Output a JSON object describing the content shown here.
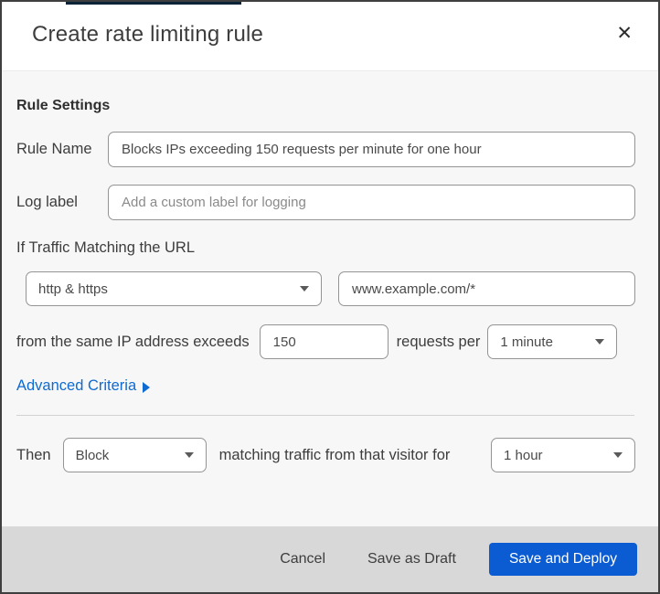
{
  "modal": {
    "title": "Create rate limiting rule",
    "close_icon": "✕"
  },
  "form": {
    "section_heading": "Rule Settings",
    "rule_name": {
      "label": "Rule Name",
      "value": "Blocks IPs exceeding 150 requests per minute for one hour"
    },
    "log_label": {
      "label": "Log label",
      "placeholder": "Add a custom label for logging"
    },
    "traffic_match": {
      "heading": "If Traffic Matching the URL",
      "scheme_selected": "http & https",
      "url_value": "www.example.com/*"
    },
    "threshold": {
      "prefix": "from the same IP address exceeds",
      "requests_value": "150",
      "middle": "requests per",
      "period_selected": "1 minute"
    },
    "advanced_criteria_label": "Advanced Criteria",
    "action": {
      "prefix": "Then",
      "action_selected": "Block",
      "middle": "matching traffic from that visitor for",
      "duration_selected": "1 hour"
    }
  },
  "footer": {
    "cancel_label": "Cancel",
    "save_draft_label": "Save as Draft",
    "save_deploy_label": "Save and Deploy"
  },
  "colors": {
    "accent_blue": "#0b5bd3",
    "link_blue": "#0f6ad1",
    "body_bg": "#f7f7f7",
    "footer_bg": "#d8d8d8",
    "backdrop_strip": "#0d2337"
  }
}
